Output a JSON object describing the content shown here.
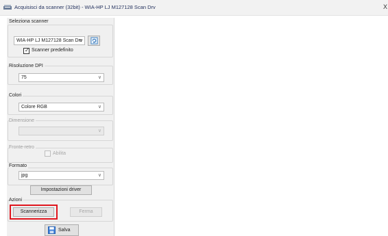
{
  "window": {
    "title": "Acquisisci da scanner (32bit) - WIA-HP LJ M127128 Scan Drv",
    "close_glyph": "X",
    "icon": "scanner-app-icon"
  },
  "scanner": {
    "label": "Seleziona scanner",
    "selected": "WIA-HP LJ M127128 Scan Drv",
    "refresh_icon": "refresh-icon",
    "default_checkbox_label": "Scanner predefinito",
    "default_checked": true
  },
  "dpi": {
    "label": "Risoluzione DPI",
    "selected": "75"
  },
  "colors": {
    "label": "Colori",
    "selected": "Colore RGB"
  },
  "dimension": {
    "label": "Dimensione",
    "selected": "",
    "enabled": false
  },
  "duplex": {
    "label": "Fronte-retro",
    "checkbox_label": "Abilita",
    "checked": false,
    "enabled": false
  },
  "format": {
    "label": "Formato",
    "selected": "jpg",
    "driver_settings_button": "Impostazioni driver"
  },
  "actions": {
    "label": "Azioni",
    "scan_button": "Scannerizza",
    "stop_button": "Ferma",
    "highlight_color": "#e0141c"
  },
  "save": {
    "button": "Salva",
    "icon": "floppy-disk-icon"
  }
}
